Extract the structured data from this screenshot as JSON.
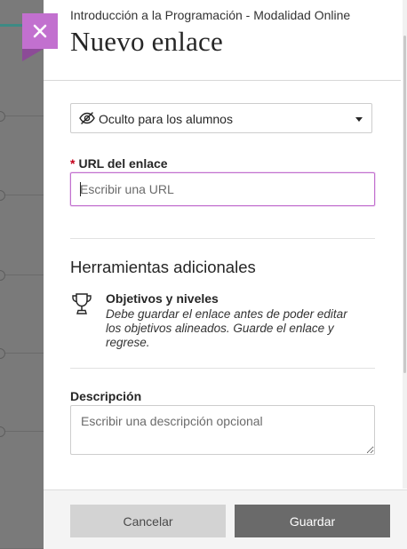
{
  "header": {
    "course_title": "Introducción a la Programación - Modalidad Online",
    "page_title": "Nuevo enlace",
    "close_label": "×"
  },
  "visibility": {
    "selected": "Oculto para los alumnos",
    "icon": "eye-slash-icon"
  },
  "url_field": {
    "required_marker": "*",
    "label": "URL del enlace",
    "placeholder": "Escribir una URL",
    "value": ""
  },
  "tools": {
    "heading": "Herramientas adicionales",
    "goals": {
      "icon": "trophy-icon",
      "title": "Objetivos y niveles",
      "description": "Debe guardar el enlace antes de poder editar los objetivos alineados. Guarde el enlace y regrese."
    }
  },
  "description_field": {
    "label": "Descripción",
    "placeholder": "Escribir una descripción opcional",
    "value": ""
  },
  "footer": {
    "cancel_label": "Cancelar",
    "save_label": "Guardar"
  },
  "colors": {
    "accent": "#c270cf",
    "required": "#c4001a",
    "save_button": "#6a6a6a",
    "cancel_button": "#d3d3d3"
  }
}
